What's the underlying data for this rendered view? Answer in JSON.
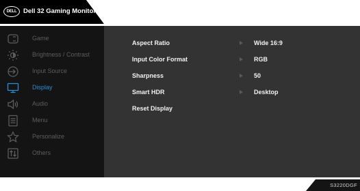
{
  "header": {
    "logo_text": "DELL",
    "title": "Dell 32 Gaming Monitor"
  },
  "sidebar": {
    "items": [
      {
        "label": "Game",
        "icon": "game-icon",
        "active": false
      },
      {
        "label": "Brightness / Contrast",
        "icon": "brightness-icon",
        "active": false
      },
      {
        "label": "Input Source",
        "icon": "input-source-icon",
        "active": false
      },
      {
        "label": "Display",
        "icon": "display-icon",
        "active": true
      },
      {
        "label": "Audio",
        "icon": "audio-icon",
        "active": false
      },
      {
        "label": "Menu",
        "icon": "menu-icon",
        "active": false
      },
      {
        "label": "Personalize",
        "icon": "personalize-icon",
        "active": false
      },
      {
        "label": "Others",
        "icon": "others-icon",
        "active": false
      }
    ]
  },
  "display_settings": {
    "rows": [
      {
        "label": "Aspect Ratio",
        "value": "Wide 16:9"
      },
      {
        "label": "Input Color Format",
        "value": "RGB"
      },
      {
        "label": "Sharpness",
        "value": "50"
      },
      {
        "label": "Smart HDR",
        "value": "Desktop"
      },
      {
        "label": "Reset Display",
        "value": ""
      }
    ]
  },
  "footer": {
    "model_code": "S3220DGF"
  },
  "colors": {
    "active": "#2b8ed6",
    "inactive": "#5d5d5d",
    "panel": "#333333",
    "sidebar": "#141414",
    "text": "#f2f2f2"
  }
}
